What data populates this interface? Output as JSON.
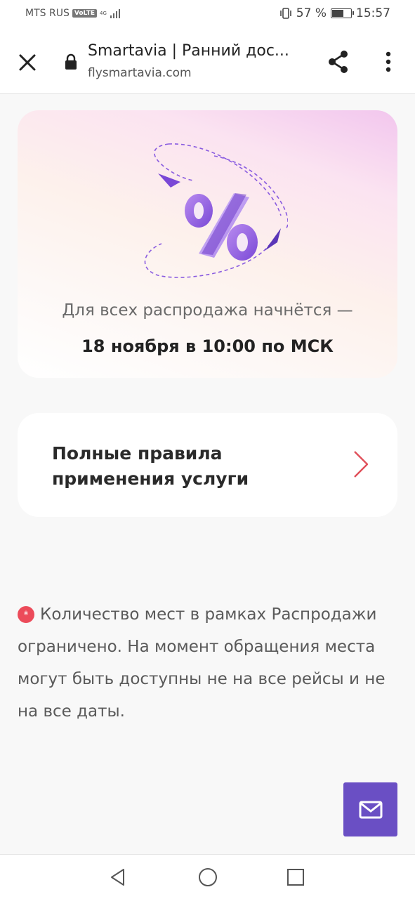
{
  "status_bar": {
    "carrier": "MTS RUS",
    "volte": "VoLTE",
    "network": "4G",
    "battery_percent": "57 %",
    "battery_level": 0.57,
    "time": "15:57",
    "icons": [
      "signal-icon",
      "vibrate-icon",
      "battery-icon"
    ]
  },
  "toolbar": {
    "title": "Smartavia | Ранний дос...",
    "url": "flysmartavia.com",
    "icons": [
      "close-icon",
      "lock-icon",
      "share-icon",
      "more-vert-icon"
    ]
  },
  "promo": {
    "art_icon": "percent-illustration",
    "line1": "Для всех распродажа начнётся —",
    "line2": "18 ноября в 10:00 по МСК"
  },
  "rules": {
    "label": "Полные правила применения услуги",
    "icon": "chevron-right-icon"
  },
  "disclaimer": {
    "badge": "*",
    "text": "Количество мест в рамках Распродажи ограничено. На момент обращения места могут быть доступны не на все рейсы и не на все даты."
  },
  "fab": {
    "icon": "mail-icon"
  },
  "nav": {
    "icons": [
      "back-icon",
      "home-icon",
      "recents-icon"
    ]
  },
  "colors": {
    "accent_purple": "#6a4fc4",
    "chevron_red": "#e0505a",
    "badge_red": "#ec4b5a"
  }
}
